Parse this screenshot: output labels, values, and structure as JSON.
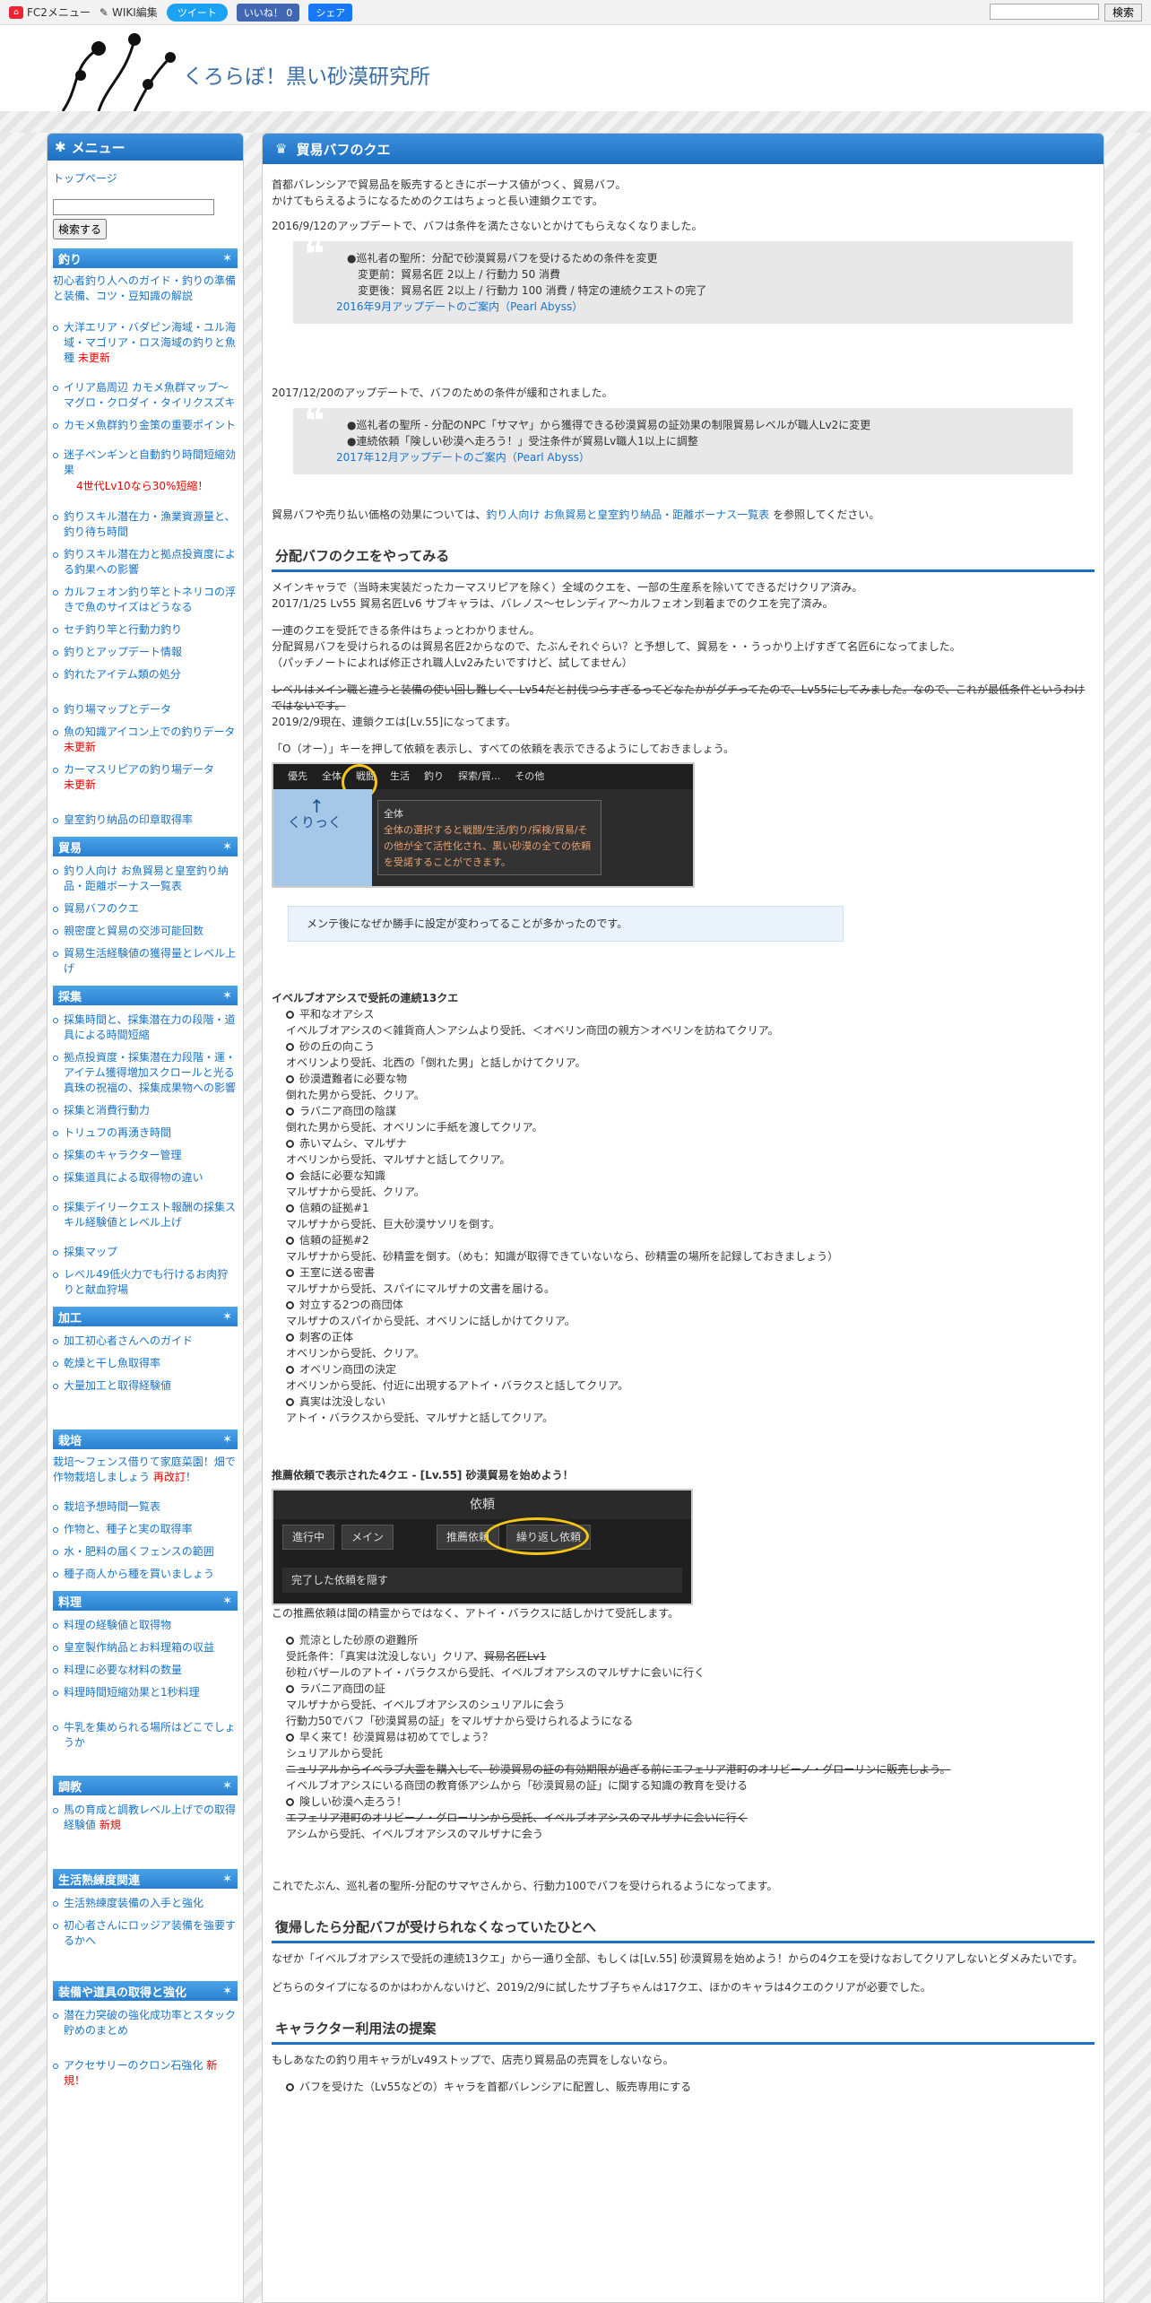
{
  "topbar": {
    "fc2": "FC2メニュー",
    "wiki": "WIKI編集",
    "tweet": "ツイート",
    "like": "いいね！ 0",
    "share": "シェア",
    "search_btn": "検索"
  },
  "site_title": "くろらぼ！黒い砂漠研究所",
  "sidebar": {
    "menu": "メニュー",
    "top": "トップページ",
    "search_btn": "検索する",
    "s1": "釣り",
    "s1_intro": "初心者釣り人へのガイド・釣りの準備と装備、コツ・豆知識の解説",
    "s1_items": [
      "大洋エリア・バダピン海域・ユル海域・マゴリア・ロス海域の釣りと魚種",
      "イリア島周辺 カモメ魚群マップ～マグロ・クロダイ・タイリクスズキ",
      "カモメ魚群釣り金策の重要ポイント",
      "迷子ペンギンと自動釣り時間短縮効果",
      "釣りスキル潜在力・漁業資源量と、釣り待ち時間",
      "釣りスキル潜在力と拠点投資度による釣果への影響",
      "カルフェオン釣り竿とトネリコの浮きで魚のサイズはどうなる",
      "セチ釣り竿と行動力釣り",
      "釣りとアップデート情報",
      "釣れたアイテム類の処分",
      "釣り場マップとデータ",
      "魚の知識アイコン上での釣りデータ",
      "カーマスリピアの釣り場データ",
      "皇室釣り納品の印章取得率"
    ],
    "s1_new": "未更新",
    "s1_note": "4世代Lv10なら30%短縮！",
    "s2": "貿易",
    "s2_items": [
      "釣り人向け お魚貿易と皇室釣り納品・距離ボーナス一覧表",
      "貿易バフのクエ",
      "親密度と貿易の交渉可能回数",
      "貿易生活経験値の獲得量とレベル上げ"
    ],
    "s3": "採集",
    "s3_items": [
      "採集時間と、採集潜在力の段階・道具による時間短縮",
      "拠点投資度・採集潜在力段階・運・アイテム獲得増加スクロールと光る真珠の祝福の、採集成果物への影響",
      "採集と消費行動力",
      "トリュフの再湧き時間",
      "採集のキャラクター管理",
      "採集道具による取得物の違い",
      "採集デイリークエスト報酬の採集スキル経験値とレベル上げ",
      "採集マップ",
      "レベル49低火力でも行けるお肉狩りと献血狩場"
    ],
    "s4": "加工",
    "s4_items": [
      "加工初心者さんへのガイド",
      "乾燥と干し魚取得率",
      "大量加工と取得経験値"
    ],
    "s5": "栽培",
    "s5_intro": "栽培～フェンス借りて家庭菜園！畑で作物栽培しましょう",
    "s5_new": "再改訂",
    "s5_items": [
      "栽培予想時間一覧表",
      "作物と、種子と実の取得率",
      "水・肥料の届くフェンスの範囲",
      "種子商人から種を買いましょう"
    ],
    "s6": "料理",
    "s6_items": [
      "料理の経験値と取得物",
      "皇室製作納品とお料理箱の収益",
      "料理に必要な材料の数量",
      "料理時間短縮効果と1秒料理",
      "牛乳を集められる場所はどこでしょうか"
    ],
    "s7": "調教",
    "s7_items": [
      "馬の育成と調教レベル上げでの取得経験値"
    ],
    "s7_new": "新規",
    "s8": "生活熟練度関連",
    "s8_items": [
      "生活熟練度装備の入手と強化",
      "初心者さんにロッジア装備を強要するかへ"
    ],
    "s9": "装備や道具の取得と強化",
    "s9_items": [
      "潜在力突破の強化成功率とスタック貯めのまとめ",
      "アクセサリーのクロン石強化"
    ],
    "s9_new": "新規！"
  },
  "main": {
    "title": "貿易バフのクエ",
    "p1": "首都バレンシアで貿易品を販売するときにボーナス値がつく、貿易バフ。",
    "p2": "かけてもらえるようになるためのクエはちょっと長い連鎖クエです。",
    "p3": "2016/9/12のアップデートで、バフは条件を満たさないとかけてもらえなくなりました。",
    "q1a": "●巡礼者の聖所：分配で砂漠貿易バフを受けるための条件を変更",
    "q1b": "変更前：貿易名匠 2以上 / 行動力 50 消費",
    "q1c": "変更後：貿易名匠 2以上 / 行動力 100 消費 / 特定の連続クエストの完了",
    "q1link": "2016年9月アップデートのご案内（Pearl Abyss）",
    "p4": "2017/12/20のアップデートで、バフのための条件が緩和されました。",
    "q2a": "●巡礼者の聖所 - 分配のNPC「サマヤ」から獲得できる砂漠貿易の証効果の制限貿易レベルが職人Lv2に変更",
    "q2b": "●連続依頼「険しい砂漠へ走ろう！」受注条件が貿易Lv職人1以上に調整",
    "q2link": "2017年12月アップデートのご案内（Pearl Abyss）",
    "p5a": "貿易バフや売り払い価格の効果については、",
    "p5link": "釣り人向け お魚貿易と皇室釣り納品・距離ボーナス一覧表",
    "p5b": "を参照してください。",
    "h2a": "分配バフのクエをやってみる",
    "p6": "メインキャラで（当時未実装だったカーマスリピアを除く）全域のクエを、一部の生産系を除いてできるだけクリア済み。",
    "p7": "2017/1/25 Lv55 貿易名匠Lv6 サブキャラは、バレノス～セレンディア～カルフェオン到着までのクエを完了済み。",
    "p8": "一連のクエを受託できる条件はちょっとわかりません。",
    "p9": "分配貿易バフを受けられるのは貿易名匠2からなので、たぶんそれぐらい？と予想して、貿易を・・うっかり上げすぎて名匠6になってました。",
    "p10": "（パッチノートによれば修正され職人Lv2みたいですけど、試してません）",
    "p11": "レベルはメイン職と違うと装備の使い回し難しく、Lv54だと討伐つらすぎるってどなたかがグチってたので、Lv55にしてみました。なので、これが最低条件というわけではないです。",
    "p12": "2019/2/9現在、連鎖クエは[Lv.55]になってます。",
    "p13": "「O（オー）」キーを押して依頼を表示し、すべての依頼を表示できるようにしておきましょう。",
    "shot1": {
      "tabs": [
        "優先",
        "全体",
        "戦闘",
        "生活",
        "釣り",
        "探索/貿...",
        "その他"
      ],
      "tip_title": "全体",
      "tip_body": "全体の選択すると戦闘/生活/釣り/探検/貿易/その他が全て活性化され、黒い砂漠の全ての依頼を受諾することができます。",
      "arrow_text": "くりっく"
    },
    "note": "メンテ後になぜか勝手に設定が変わってることが多かったのです。",
    "chain_title": "イベルブオアシスで受託の連続13クエ",
    "chain": [
      {
        "t": "平和なオアシス",
        "d": "イベルブオアシスの＜雑貨商人＞アシムより受託、＜オベリン商団の親方＞オベリンを訪ねてクリア。"
      },
      {
        "t": "砂の丘の向こう",
        "d": "オベリンより受託、北西の「倒れた男」と話しかけてクリア。"
      },
      {
        "t": "砂漠遭難者に必要な物",
        "d": "倒れた男から受託、クリア。"
      },
      {
        "t": "ラバニア商団の陰謀",
        "d": "倒れた男から受託、オベリンに手紙を渡してクリア。"
      },
      {
        "t": "赤いマムシ、マルザナ",
        "d": "オベリンから受託、マルザナと話してクリア。"
      },
      {
        "t": "会話に必要な知識",
        "d": "マルザナから受託、クリア。"
      },
      {
        "t": "信頼の証拠#1",
        "d": "マルザナから受託、巨大砂漠サソリを倒す。"
      },
      {
        "t": "信頼の証拠#2",
        "d": "マルザナから受託、砂精霊を倒す。（めも：知識が取得できていないなら、砂精霊の場所を記録しておきましょう）"
      },
      {
        "t": "王室に送る密書",
        "d": "マルザナから受託、スパイにマルザナの文書を届ける。"
      },
      {
        "t": "対立する2つの商団体",
        "d": "マルザナのスパイから受託、オベリンに話しかけてクリア。"
      },
      {
        "t": "刺客の正体",
        "d": "オベリンから受託、クリア。"
      },
      {
        "t": "オベリン商団の決定",
        "d": "オベリンから受託、付近に出現するアトイ・バラクスと話してクリア。"
      },
      {
        "t": "真実は沈没しない",
        "d": "アトイ・バラクスから受託、マルザナと話してクリア。"
      }
    ],
    "rec_title": "推薦依頼で表示された4クエ - [Lv.55] 砂漠貿易を始めよう！",
    "shot2": {
      "title": "依頼",
      "tabs": [
        "進行中",
        "メイン",
        "推薦依頼",
        "繰り返し依頼"
      ],
      "check": "完了した依頼を隠す"
    },
    "p14": "この推薦依頼は聞の精霊からではなく、アトイ・バラクスに話しかけて受託します。",
    "rec": [
      {
        "t": "荒涼とした砂原の避難所",
        "d1": "受託条件：「真実は沈没しない」クリア、",
        "s1": "貿易名匠Lv1",
        "d2": "砂粒バザールのアトイ・バラクスから受託、イベルブオアシスのマルザナに会いに行く"
      },
      {
        "t": "ラバニア商団の証",
        "d1": "マルザナから受託、イベルブオアシスのシュリアルに会う",
        "d2": "行動力50でバフ「砂漠貿易の証」をマルザナから受けられるようになる"
      },
      {
        "t": "早く来て！砂漠貿易は初めてでしょう？",
        "d1": "シュリアルから受託",
        "s1": "ニュリアルからイベラブ大霊を購入して、砂漠貿易の証の有効期限が過ぎる前にエフェリア港町のオリビーノ・グローリンに販売しよう。",
        "d2": "イベルブオアシスにいる商団の教育係アシムから「砂漠貿易の証」に関する知識の教育を受ける"
      },
      {
        "t": "険しい砂漠へ走ろう！",
        "s1": "エフェリア港町のオリビーノ・グローリンから受託、イベルブオアシスのマルザナに会いに行く",
        "d2": "アシムから受託、イベルブオアシスのマルザナに会う"
      }
    ],
    "p15": "これでたぶん、巡礼者の聖所-分配のサマヤさんから、行動力100でバフを受けられるようになってます。",
    "h2b": "復帰したら分配バフが受けられなくなっていたひとへ",
    "p16": "なぜか「イベルブオアシスで受託の連続13クエ」から一通り全部、もしくは[Lv.55] 砂漠貿易を始めよう！からの4クエを受けなおしてクリアしないとダメみたいです。",
    "p17": "どちらのタイプになるのかはわかんないけど、2019/2/9に試したサブ子ちゃんは17クエ、ほかのキャラは4クエのクリアが必要でした。",
    "h2c": "キャラクター利用法の提案",
    "p18": "もしあなたの釣り用キャラがLv49ストップで、店売り貿易品の売買をしないなら。",
    "p19": "バフを受けた（Lv55などの）キャラを首都バレンシアに配置し、販売専用にする"
  }
}
